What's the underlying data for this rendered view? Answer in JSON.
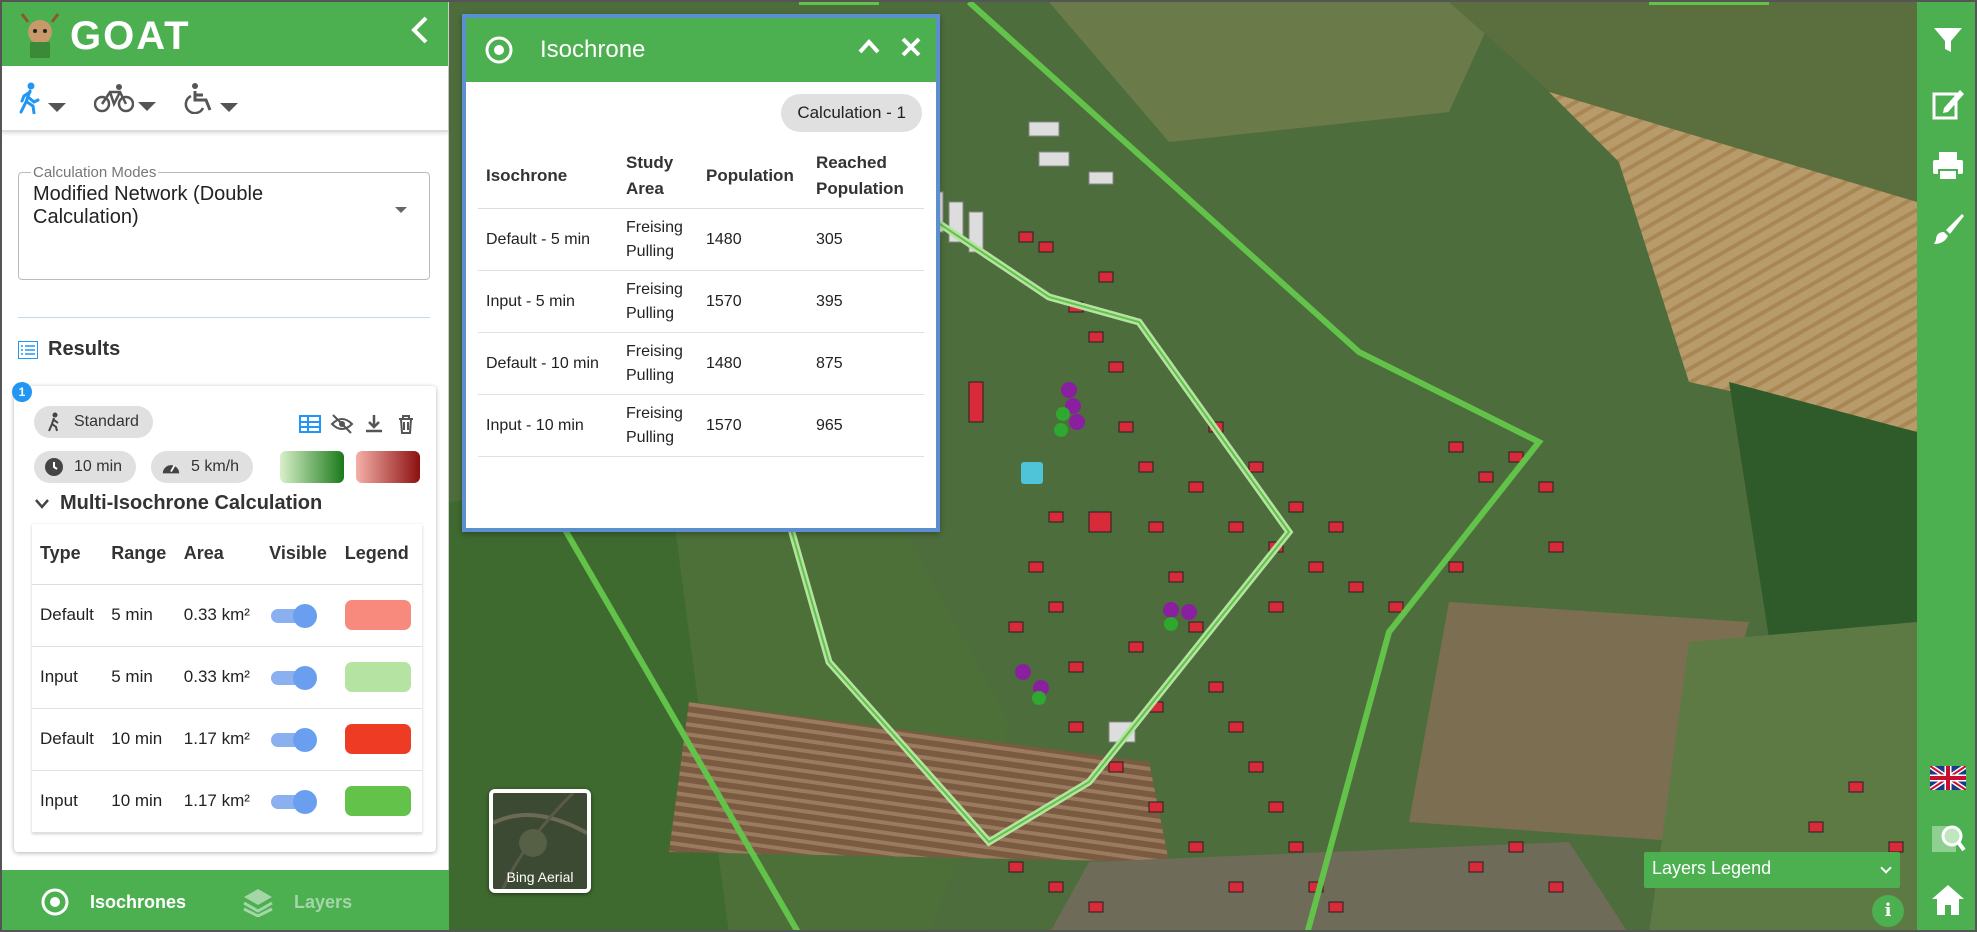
{
  "app": {
    "logo_text": "GOAT"
  },
  "colors": {
    "brand_green": "#4caf50",
    "popup_border": "#5b8fd0"
  },
  "modes": [
    {
      "name": "walking",
      "icon": "walk-icon"
    },
    {
      "name": "bicycle",
      "icon": "bicycle-icon"
    },
    {
      "name": "wheelchair",
      "icon": "wheelchair-icon"
    }
  ],
  "calculation_modes": {
    "label": "Calculation Modes",
    "value": "Modified Network (Double Calculation)"
  },
  "results": {
    "title": "Results",
    "card": {
      "number": "1",
      "routing": "Standard",
      "time": "10 min",
      "speed": "5 km/h",
      "multi_title": "Multi-Isochrone Calculation",
      "columns": [
        "Type",
        "Range",
        "Area",
        "Visible",
        "Legend"
      ],
      "rows": [
        {
          "type": "Default",
          "range": "5 min",
          "area": "0.33 km²",
          "visible": true,
          "color": "#f78a7c"
        },
        {
          "type": "Input",
          "range": "5 min",
          "area": "0.33 km²",
          "visible": true,
          "color": "#b5e3a1"
        },
        {
          "type": "Default",
          "range": "10 min",
          "area": "1.17 km²",
          "visible": true,
          "color": "#ee3b24"
        },
        {
          "type": "Input",
          "range": "10 min",
          "area": "1.17 km²",
          "visible": true,
          "color": "#62c24a"
        }
      ]
    }
  },
  "bottom_nav": {
    "isochrones": "Isochrones",
    "layers": "Layers"
  },
  "isochrone_popup": {
    "title": "Isochrone",
    "calc_chip": "Calculation - 1",
    "columns": [
      "Isochrone",
      "Study Area",
      "Population",
      "Reached Population"
    ],
    "rows": [
      {
        "isochrone": "Default - 5 min",
        "study_area": "Freising Pulling",
        "population": "1480",
        "reached": "305"
      },
      {
        "isochrone": "Input - 5 min",
        "study_area": "Freising Pulling",
        "population": "1570",
        "reached": "395"
      },
      {
        "isochrone": "Default - 10 min",
        "study_area": "Freising Pulling",
        "population": "1480",
        "reached": "875"
      },
      {
        "isochrone": "Input - 10 min",
        "study_area": "Freising Pulling",
        "population": "1570",
        "reached": "965"
      }
    ]
  },
  "map": {
    "basemap_label": "Bing Aerial",
    "layers_legend": "Layers Legend",
    "info": "i"
  },
  "toolbar": [
    "filter-icon",
    "edit-icon",
    "print-icon",
    "brush-icon",
    "uk-flag-icon",
    "map-search-icon",
    "home-icon"
  ]
}
